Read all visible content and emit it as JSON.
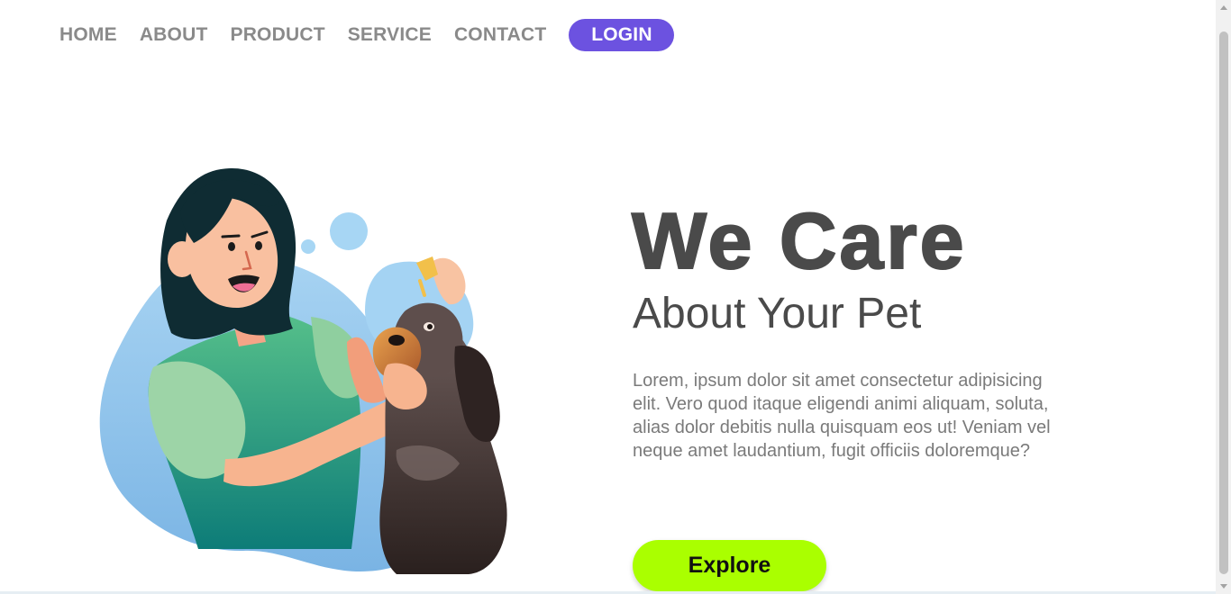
{
  "nav": {
    "items": [
      "HOME",
      "ABOUT",
      "PRODUCT",
      "SERVICE",
      "CONTACT"
    ],
    "login_label": "LOGIN"
  },
  "hero": {
    "title": "We Care",
    "subtitle": "About Your Pet",
    "description": "Lorem, ipsum dolor sit amet consectetur adipisicing elit. Vero quod itaque eligendi animi aliquam, soluta, alias dolor debitis nulla quisquam eos ut! Veniam vel neque amet laudantium, fugit officiis doloremque?",
    "button_label": "Explore"
  },
  "colors": {
    "nav_text": "#8a8a8a",
    "login_bg": "#6c52e0",
    "heading": "#4a4a4a",
    "body_text": "#7a7a7a",
    "explore_bg": "#aaff00",
    "blob": "#8cc4ec"
  },
  "illustration": {
    "icon": "woman-giving-dog-eye-drops-illustration"
  }
}
